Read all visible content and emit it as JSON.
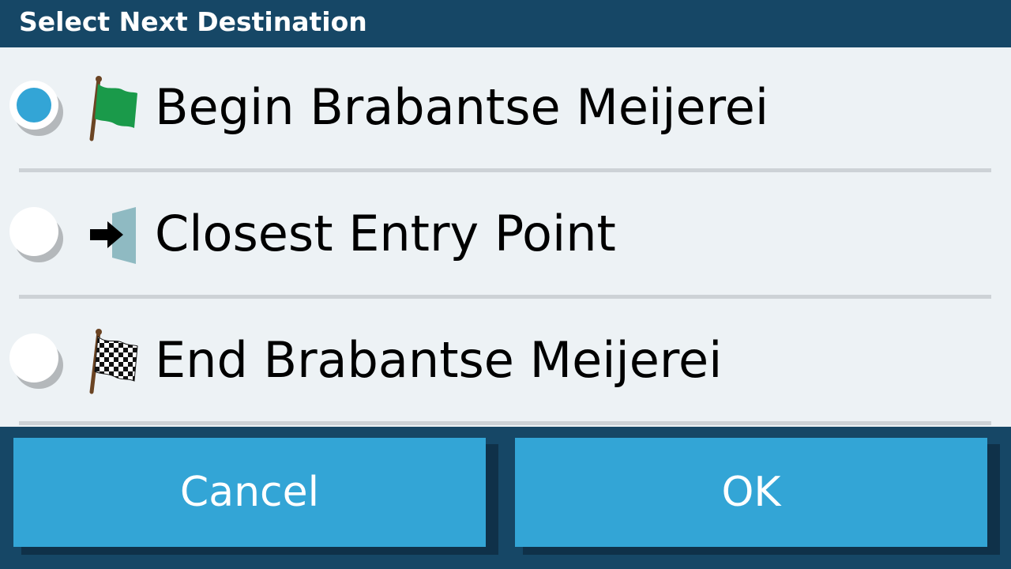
{
  "header": {
    "title": "Select Next Destination"
  },
  "options": [
    {
      "label": "Begin Brabantse Meijerei",
      "icon": "green-flag-icon",
      "selected": true
    },
    {
      "label": "Closest Entry Point",
      "icon": "entry-arrow-icon",
      "selected": false
    },
    {
      "label": "End Brabantse Meijerei",
      "icon": "checkered-flag-icon",
      "selected": false
    }
  ],
  "buttons": {
    "cancel_label": "Cancel",
    "ok_label": "OK"
  },
  "colors": {
    "header_bg": "#164766",
    "content_bg": "#edf2f5",
    "accent": "#33a5d6",
    "flag_green": "#1a9a4a",
    "divider": "#cdd2d6"
  }
}
